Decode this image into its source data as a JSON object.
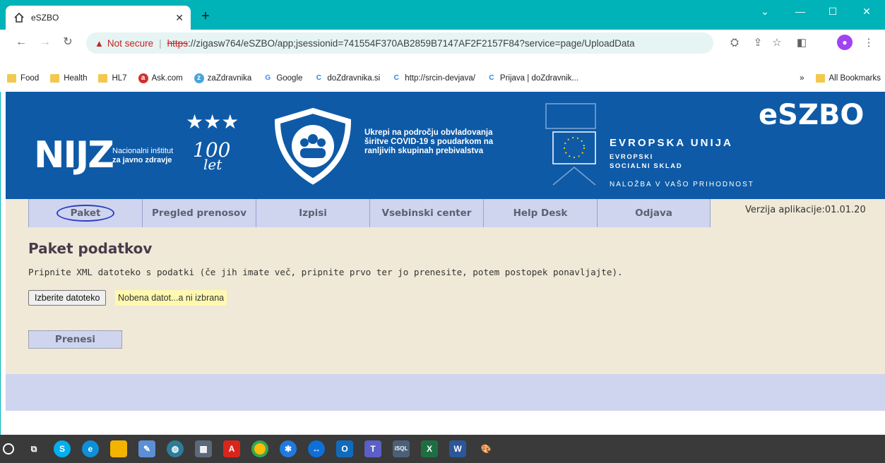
{
  "browser": {
    "tab_title": "eSZBO",
    "url_warning": "Not secure",
    "url_scheme": "https",
    "url_rest": "://zigasw764/eSZBO/app;jsessionid=741554F370AB2859B7147AF2F2157F84?service=page/UploadData",
    "bookmarks": [
      "Food",
      "Health",
      "HL7",
      "Ask.com",
      "zaZdravnika",
      "Google",
      "doZdravnika.si",
      "http://srcin-devjava/",
      "Prijava | doZdravnik..."
    ],
    "bookmarks_more": "»",
    "all_bookmarks": "All Bookmarks"
  },
  "banner": {
    "nijz": "NIJZ",
    "nijz_sub1": "Nacionalni inštitut",
    "nijz_sub2": "za javno zdravje",
    "anniversary": "100 let",
    "ukrepi1": "Ukrepi na področju obvladovanja",
    "ukrepi2": "širitve COVID-19 s poudarkom na",
    "ukrepi3": "ranljivih skupinah prebivalstva",
    "eu1": "EVROPSKA UNIJA",
    "eu2": "EVROPSKI",
    "eu3": "SOCIALNI SKLAD",
    "eu4": "NALOŽBA V VAŠO PRIHODNOST",
    "app": "eSZBO"
  },
  "menu": {
    "items": [
      "Paket",
      "Pregled prenosov",
      "Izpisi",
      "Vsebinski center",
      "Help Desk",
      "Odjava"
    ],
    "version": "Verzija aplikacije:01.01.20"
  },
  "page": {
    "title": "Paket podatkov",
    "description": "Pripnite XML datoteko s podatki (če jih imate več, pripnite prvo ter jo prenesite, potem postopek ponavljajte).",
    "file_button": "Izberite datoteko",
    "file_status": "Nobena datot...a ni izbrana",
    "upload_button": "Prenesi"
  },
  "colors": {
    "banner": "#0e5aa7",
    "menu_bg": "#f0e9d7",
    "menu_item": "#cfd5ef",
    "chrome": "#00b3b8"
  }
}
